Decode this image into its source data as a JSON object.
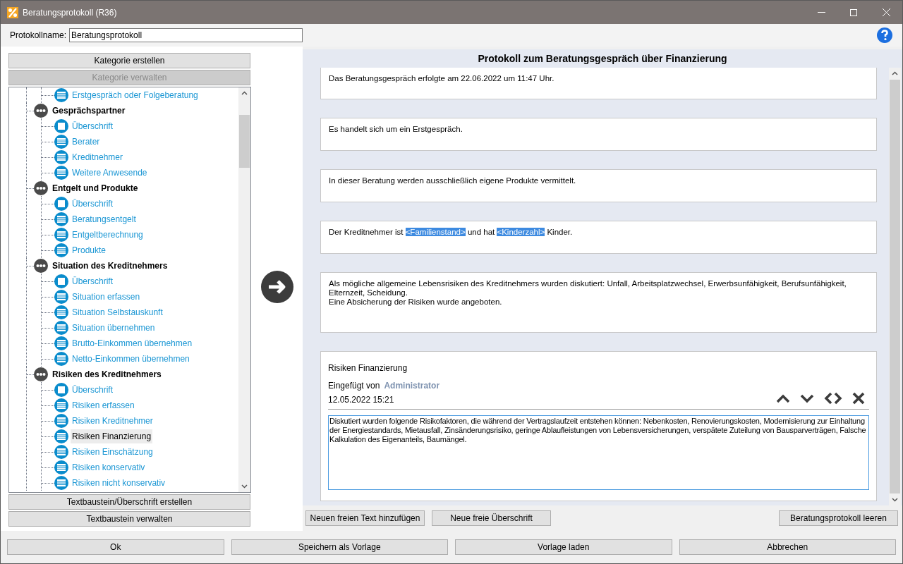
{
  "window": {
    "title": "Beratungsprotokoll (R36)"
  },
  "name_field": {
    "label": "Protokollname:",
    "value": "Beratungsprotokoll"
  },
  "category_buttons": [
    {
      "label": "Kategorie erstellen",
      "disabled": false
    },
    {
      "label": "Kategorie verwalten",
      "disabled": true
    }
  ],
  "tree": [
    {
      "children": [
        {
          "label": "Erstgespräch oder Folgeberatung",
          "kind": "text",
          "selected": false
        }
      ]
    },
    {
      "label": "Gesprächspartner",
      "selected": false,
      "children": [
        {
          "label": "Überschrift",
          "kind": "heading",
          "selected": false
        },
        {
          "label": "Berater",
          "kind": "text",
          "selected": false
        },
        {
          "label": "Kreditnehmer",
          "kind": "text",
          "selected": false
        },
        {
          "label": "Weitere Anwesende",
          "kind": "text",
          "selected": false
        }
      ]
    },
    {
      "label": "Entgelt und Produkte",
      "selected": false,
      "children": [
        {
          "label": "Überschrift",
          "kind": "heading",
          "selected": false
        },
        {
          "label": "Beratungsentgelt",
          "kind": "text",
          "selected": false
        },
        {
          "label": "Entgeltberechnung",
          "kind": "text",
          "selected": false
        },
        {
          "label": "Produkte",
          "kind": "text",
          "selected": false
        }
      ]
    },
    {
      "label": "Situation des Kreditnehmers",
      "selected": false,
      "children": [
        {
          "label": "Überschrift",
          "kind": "heading",
          "selected": false
        },
        {
          "label": "Situation erfassen",
          "kind": "text",
          "selected": false
        },
        {
          "label": "Situation Selbstauskunft",
          "kind": "text",
          "selected": false
        },
        {
          "label": "Situation übernehmen",
          "kind": "text",
          "selected": false
        },
        {
          "label": "Brutto-Einkommen übernehmen",
          "kind": "text",
          "selected": false
        },
        {
          "label": "Netto-Einkommen übernehmen",
          "kind": "text",
          "selected": false
        }
      ]
    },
    {
      "label": "Risiken des Kreditnehmers",
      "selected": false,
      "children": [
        {
          "label": "Überschrift",
          "kind": "heading",
          "selected": false
        },
        {
          "label": "Risiken erfassen",
          "kind": "text",
          "selected": false
        },
        {
          "label": "Risiken Kreditnehmer",
          "kind": "text",
          "selected": false
        },
        {
          "label": "Risiken Finanzierung",
          "kind": "text",
          "selected": true
        },
        {
          "label": "Risiken Einschätzung",
          "kind": "text",
          "selected": false
        },
        {
          "label": "Risiken konservativ",
          "kind": "text",
          "selected": false
        },
        {
          "label": "Risiken nicht konservativ",
          "kind": "text",
          "selected": false
        }
      ]
    }
  ],
  "block_buttons": [
    "Textbaustein/Überschrift erstellen",
    "Textbaustein verwalten"
  ],
  "protocol": {
    "title": "Protokoll zum Beratungsgespräch über Finanzierung",
    "cards": [
      {
        "kind": "text",
        "lines": [
          [
            {
              "text": "Das Beratungsgespräch erfolgte am 22.06.2022 um 11:47 Uhr.",
              "placeholder": false
            }
          ]
        ]
      },
      {
        "kind": "text",
        "lines": [
          [
            {
              "text": "Es handelt sich um ein Erstgespräch.",
              "placeholder": false
            }
          ]
        ]
      },
      {
        "kind": "text",
        "lines": [
          [
            {
              "text": "In dieser Beratung werden ausschließlich eigene Produkte vermittelt.",
              "placeholder": false
            }
          ]
        ]
      },
      {
        "kind": "text",
        "lines": [
          [
            {
              "text": "Der Kreditnehmer ist ",
              "placeholder": false
            },
            {
              "text": "<Familienstand>",
              "placeholder": true
            },
            {
              "text": " und hat ",
              "placeholder": false
            },
            {
              "text": "<Kinderzahl>",
              "placeholder": true
            },
            {
              "text": " Kinder.",
              "placeholder": false
            }
          ]
        ]
      },
      {
        "kind": "text",
        "lines": [
          [
            {
              "text": "Als mögliche allgemeine Lebensrisiken des Kreditnehmers wurden diskutiert: Unfall, Arbeitsplatzwechsel, Erwerbsunfähigkeit, Berufsunfähigkeit, Elternzeit, Scheidung.",
              "placeholder": false
            }
          ],
          [
            {
              "text": "Eine Absicherung der Risiken wurde angeboten.",
              "placeholder": false
            }
          ]
        ]
      },
      {
        "kind": "edit",
        "title": "Risiken Finanzierung",
        "inserted_label": "Eingefügt von",
        "author": "Administrator",
        "date": "12.05.2022 15:21",
        "text": "Diskutiert wurden folgende Risikofaktoren, die während der Vertragslaufzeit entstehen können: Nebenkosten, Renovierungskosten, Modernisierung zur Einhaltung der Energiestandards, Mietausfall, Zinsänderungsrisiko, geringe Ablaufleistungen von Lebensversicherungen, verspätete Zuteilung von Bausparverträgen, Falsche Kalkulation des Eigenanteils, Baumängel. "
      }
    ]
  },
  "protocol_buttons": [
    "Neuen freien Text hinzufügen",
    "Neue freie Überschrift"
  ],
  "clear_button": "Beratungsprotokoll leeren",
  "footer_buttons": [
    "Ok",
    "Speichern als Vorlage",
    "Vorlage laden",
    "Abbrechen"
  ]
}
